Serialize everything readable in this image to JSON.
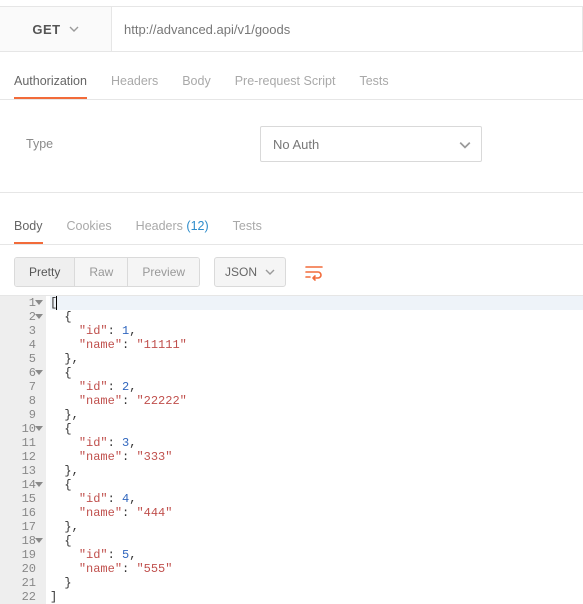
{
  "request": {
    "method": "GET",
    "url": "http://advanced.api/v1/goods"
  },
  "reqTabs": {
    "authorization": "Authorization",
    "headers": "Headers",
    "body": "Body",
    "prereq": "Pre-request Script",
    "tests": "Tests"
  },
  "auth": {
    "typeLabel": "Type",
    "selected": "No Auth"
  },
  "respTabs": {
    "body": "Body",
    "cookies": "Cookies",
    "headers": "Headers",
    "headersCount": "(12)",
    "tests": "Tests"
  },
  "format": {
    "pretty": "Pretty",
    "raw": "Raw",
    "preview": "Preview",
    "lang": "JSON"
  },
  "code": {
    "lines": [
      {
        "n": "1",
        "fold": true,
        "indent": 0,
        "tokens": [
          [
            "punc",
            "["
          ]
        ],
        "hl": true,
        "cursor": true
      },
      {
        "n": "2",
        "fold": true,
        "indent": 1,
        "tokens": [
          [
            "punc",
            "{"
          ]
        ]
      },
      {
        "n": "3",
        "fold": false,
        "indent": 2,
        "tokens": [
          [
            "key",
            "\"id\""
          ],
          [
            "punc",
            ": "
          ],
          [
            "num",
            "1"
          ],
          [
            "punc",
            ","
          ]
        ]
      },
      {
        "n": "4",
        "fold": false,
        "indent": 2,
        "tokens": [
          [
            "key",
            "\"name\""
          ],
          [
            "punc",
            ": "
          ],
          [
            "str",
            "\"11111\""
          ]
        ]
      },
      {
        "n": "5",
        "fold": false,
        "indent": 1,
        "tokens": [
          [
            "punc",
            "},"
          ]
        ]
      },
      {
        "n": "6",
        "fold": true,
        "indent": 1,
        "tokens": [
          [
            "punc",
            "{"
          ]
        ]
      },
      {
        "n": "7",
        "fold": false,
        "indent": 2,
        "tokens": [
          [
            "key",
            "\"id\""
          ],
          [
            "punc",
            ": "
          ],
          [
            "num",
            "2"
          ],
          [
            "punc",
            ","
          ]
        ]
      },
      {
        "n": "8",
        "fold": false,
        "indent": 2,
        "tokens": [
          [
            "key",
            "\"name\""
          ],
          [
            "punc",
            ": "
          ],
          [
            "str",
            "\"22222\""
          ]
        ]
      },
      {
        "n": "9",
        "fold": false,
        "indent": 1,
        "tokens": [
          [
            "punc",
            "},"
          ]
        ]
      },
      {
        "n": "10",
        "fold": true,
        "indent": 1,
        "tokens": [
          [
            "punc",
            "{"
          ]
        ]
      },
      {
        "n": "11",
        "fold": false,
        "indent": 2,
        "tokens": [
          [
            "key",
            "\"id\""
          ],
          [
            "punc",
            ": "
          ],
          [
            "num",
            "3"
          ],
          [
            "punc",
            ","
          ]
        ]
      },
      {
        "n": "12",
        "fold": false,
        "indent": 2,
        "tokens": [
          [
            "key",
            "\"name\""
          ],
          [
            "punc",
            ": "
          ],
          [
            "str",
            "\"333\""
          ]
        ]
      },
      {
        "n": "13",
        "fold": false,
        "indent": 1,
        "tokens": [
          [
            "punc",
            "},"
          ]
        ]
      },
      {
        "n": "14",
        "fold": true,
        "indent": 1,
        "tokens": [
          [
            "punc",
            "{"
          ]
        ]
      },
      {
        "n": "15",
        "fold": false,
        "indent": 2,
        "tokens": [
          [
            "key",
            "\"id\""
          ],
          [
            "punc",
            ": "
          ],
          [
            "num",
            "4"
          ],
          [
            "punc",
            ","
          ]
        ]
      },
      {
        "n": "16",
        "fold": false,
        "indent": 2,
        "tokens": [
          [
            "key",
            "\"name\""
          ],
          [
            "punc",
            ": "
          ],
          [
            "str",
            "\"444\""
          ]
        ]
      },
      {
        "n": "17",
        "fold": false,
        "indent": 1,
        "tokens": [
          [
            "punc",
            "},"
          ]
        ]
      },
      {
        "n": "18",
        "fold": true,
        "indent": 1,
        "tokens": [
          [
            "punc",
            "{"
          ]
        ]
      },
      {
        "n": "19",
        "fold": false,
        "indent": 2,
        "tokens": [
          [
            "key",
            "\"id\""
          ],
          [
            "punc",
            ": "
          ],
          [
            "num",
            "5"
          ],
          [
            "punc",
            ","
          ]
        ]
      },
      {
        "n": "20",
        "fold": false,
        "indent": 2,
        "tokens": [
          [
            "key",
            "\"name\""
          ],
          [
            "punc",
            ": "
          ],
          [
            "str",
            "\"555\""
          ]
        ]
      },
      {
        "n": "21",
        "fold": false,
        "indent": 1,
        "tokens": [
          [
            "punc",
            "}"
          ]
        ]
      },
      {
        "n": "22",
        "fold": false,
        "indent": 0,
        "tokens": [
          [
            "punc",
            "]"
          ]
        ]
      }
    ]
  }
}
